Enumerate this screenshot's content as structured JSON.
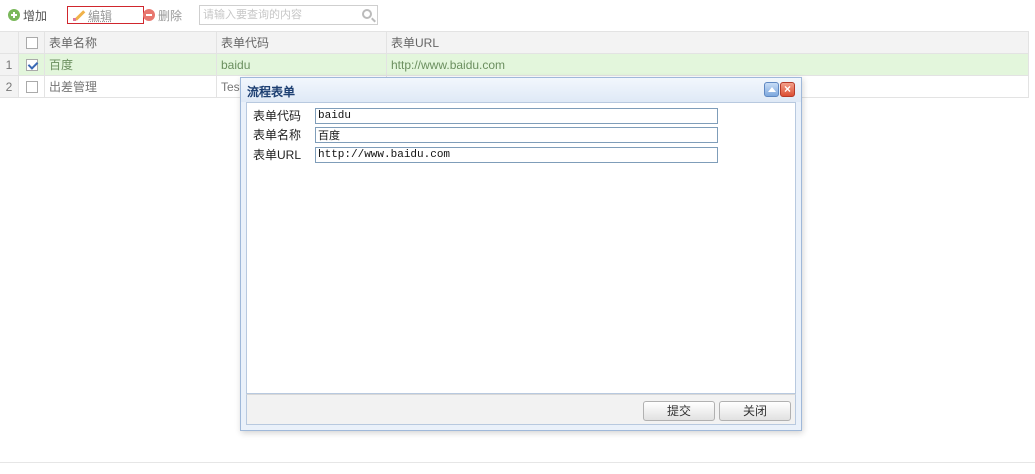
{
  "toolbar": {
    "add_label": "增加",
    "edit_label": "编辑",
    "delete_label": "删除",
    "search_placeholder": "请输入要查询的内容"
  },
  "grid": {
    "columns": [
      "表单名称",
      "表单代码",
      "表单URL"
    ],
    "rows": [
      {
        "num": "1",
        "checked": true,
        "name": "百度",
        "code": "baidu",
        "url": "http://www.baidu.com"
      },
      {
        "num": "2",
        "checked": false,
        "name": "出差管理",
        "code": "Test",
        "url": ""
      }
    ]
  },
  "dialog": {
    "title": "流程表单",
    "fields": [
      {
        "label": "表单代码",
        "value": "baidu"
      },
      {
        "label": "表单名称",
        "value": "百度"
      },
      {
        "label": "表单URL",
        "value": "http://www.baidu.com"
      }
    ],
    "submit_label": "提交",
    "close_label": "关闭"
  },
  "colors": {
    "selected_row": "#e3f6dc",
    "dialog_title_text": "#1d3f72",
    "edit_highlight_border": "#d0262d"
  }
}
